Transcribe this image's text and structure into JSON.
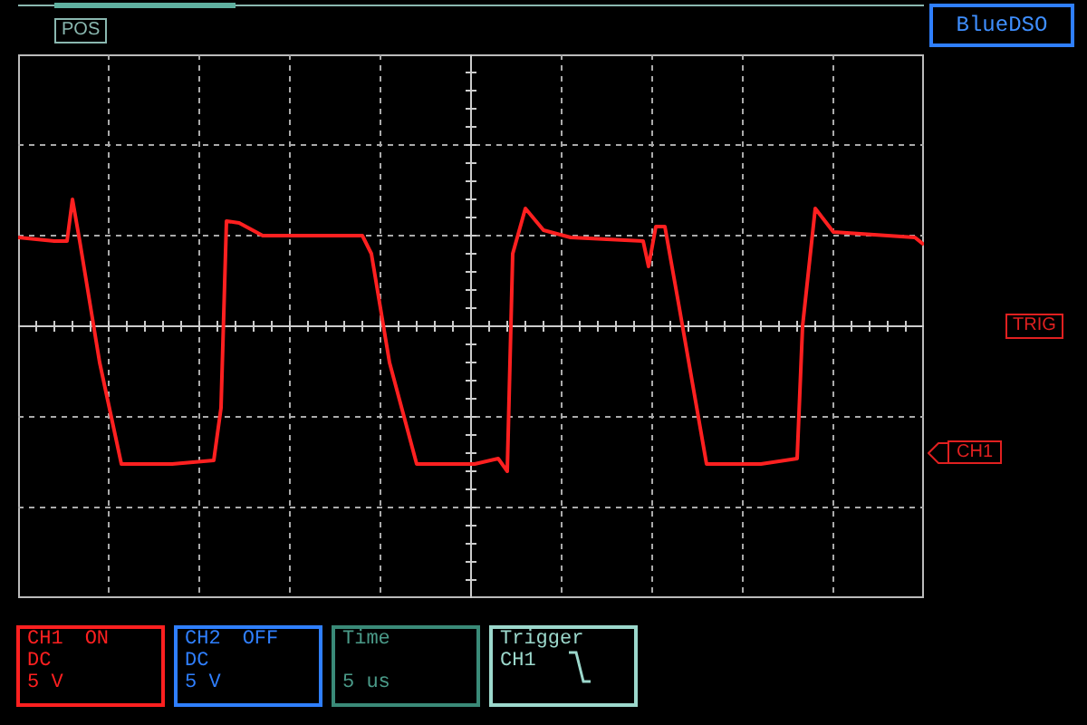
{
  "header": {
    "position_label": "POS",
    "brand": "BlueDSO"
  },
  "markers": [
    {
      "label": "TRIG",
      "kind": "trigger"
    },
    {
      "label": "CH1",
      "kind": "channel"
    }
  ],
  "channels": [
    {
      "name": "CH1",
      "state": "ON",
      "coupling": "DC",
      "scale": "5 V",
      "color": "#ff2020"
    },
    {
      "name": "CH2",
      "state": "OFF",
      "coupling": "DC",
      "scale": "5 V",
      "color": "#2f7fff"
    }
  ],
  "time": {
    "title": "Time",
    "value": "5 us"
  },
  "trigger": {
    "title": "Trigger",
    "source": "CH1"
  }
}
